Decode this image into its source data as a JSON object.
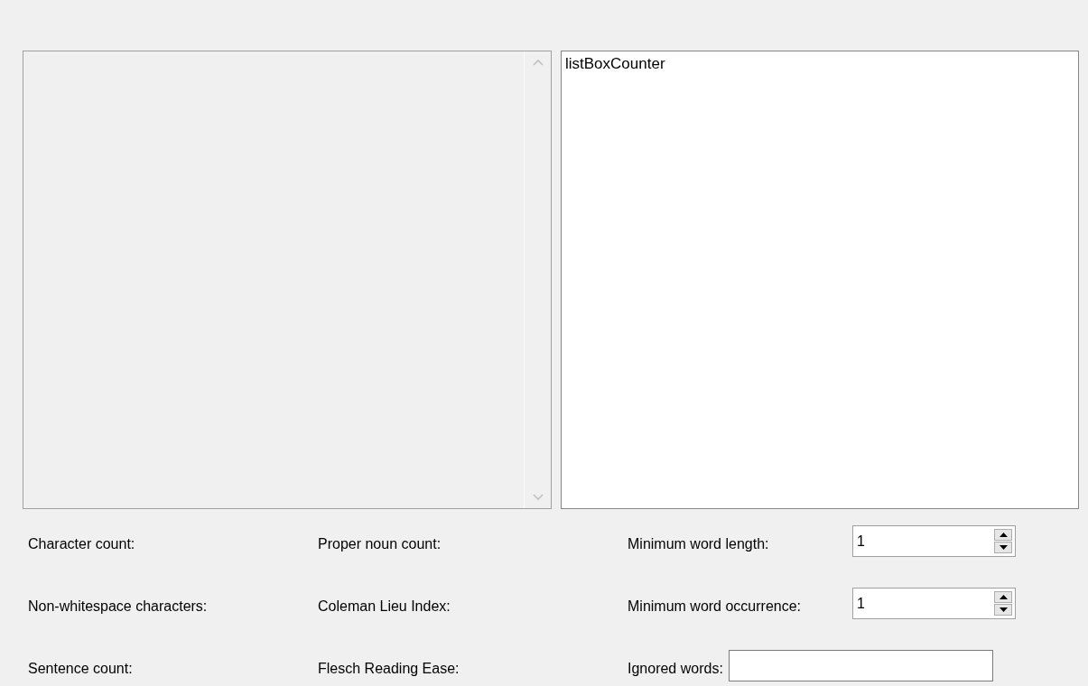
{
  "list_box": {
    "items": [
      "listBoxCounter"
    ]
  },
  "stats": [
    {
      "label": "Character count:"
    },
    {
      "label": "Proper noun count:"
    },
    {
      "label": "Non-whitespace characters:"
    },
    {
      "label": "Coleman Lieu Index:"
    },
    {
      "label": "Sentence count:"
    },
    {
      "label": "Flesch Reading Ease:"
    }
  ],
  "settings": [
    {
      "kind": "spinner",
      "label": "Minimum word length:",
      "value": "1"
    },
    {
      "kind": "spinner",
      "label": "Minimum word occurrence:",
      "value": "1"
    },
    {
      "kind": "text",
      "label": "Ignored words:"
    }
  ]
}
